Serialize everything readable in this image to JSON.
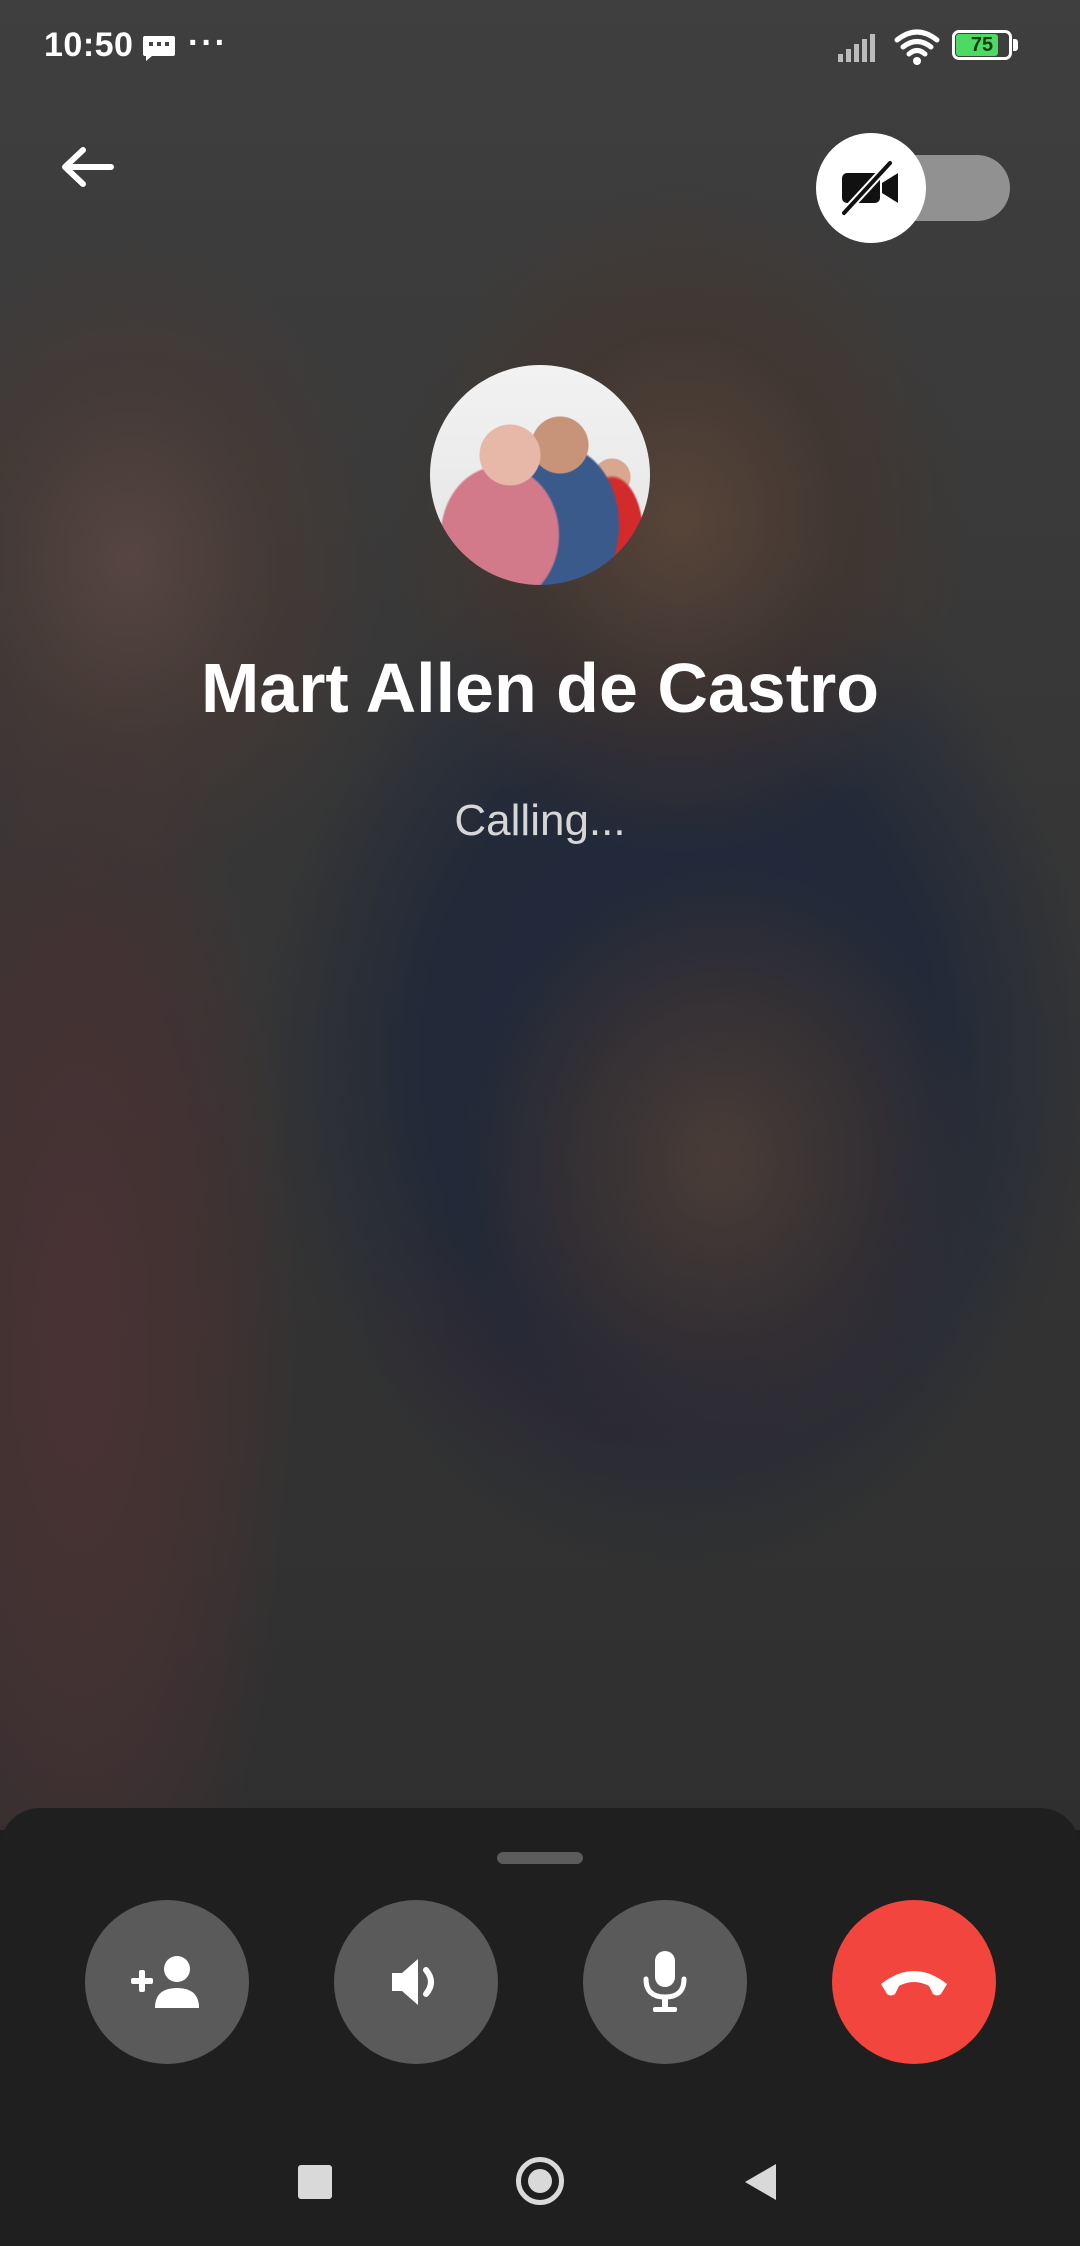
{
  "status_bar": {
    "time": "10:50",
    "dots": "···",
    "battery_level": "75",
    "message_icon": "message-icon",
    "signal_icon": "signal-icon",
    "wifi_icon": "wifi-icon"
  },
  "header": {
    "back_icon": "back-arrow-icon",
    "video_off_icon": "video-off-icon",
    "video_enabled": false
  },
  "caller": {
    "name": "Mart Allen de Castro",
    "status": "Calling..."
  },
  "controls": [
    {
      "name": "add-person",
      "icon": "add-person-icon"
    },
    {
      "name": "speaker",
      "icon": "speaker-icon"
    },
    {
      "name": "microphone",
      "icon": "microphone-icon"
    },
    {
      "name": "end-call",
      "icon": "end-call-icon",
      "color": "#f2453d"
    }
  ],
  "nav_bar": {
    "recent_icon": "recent-apps-icon",
    "home_icon": "home-icon",
    "back_icon": "nav-back-icon"
  }
}
